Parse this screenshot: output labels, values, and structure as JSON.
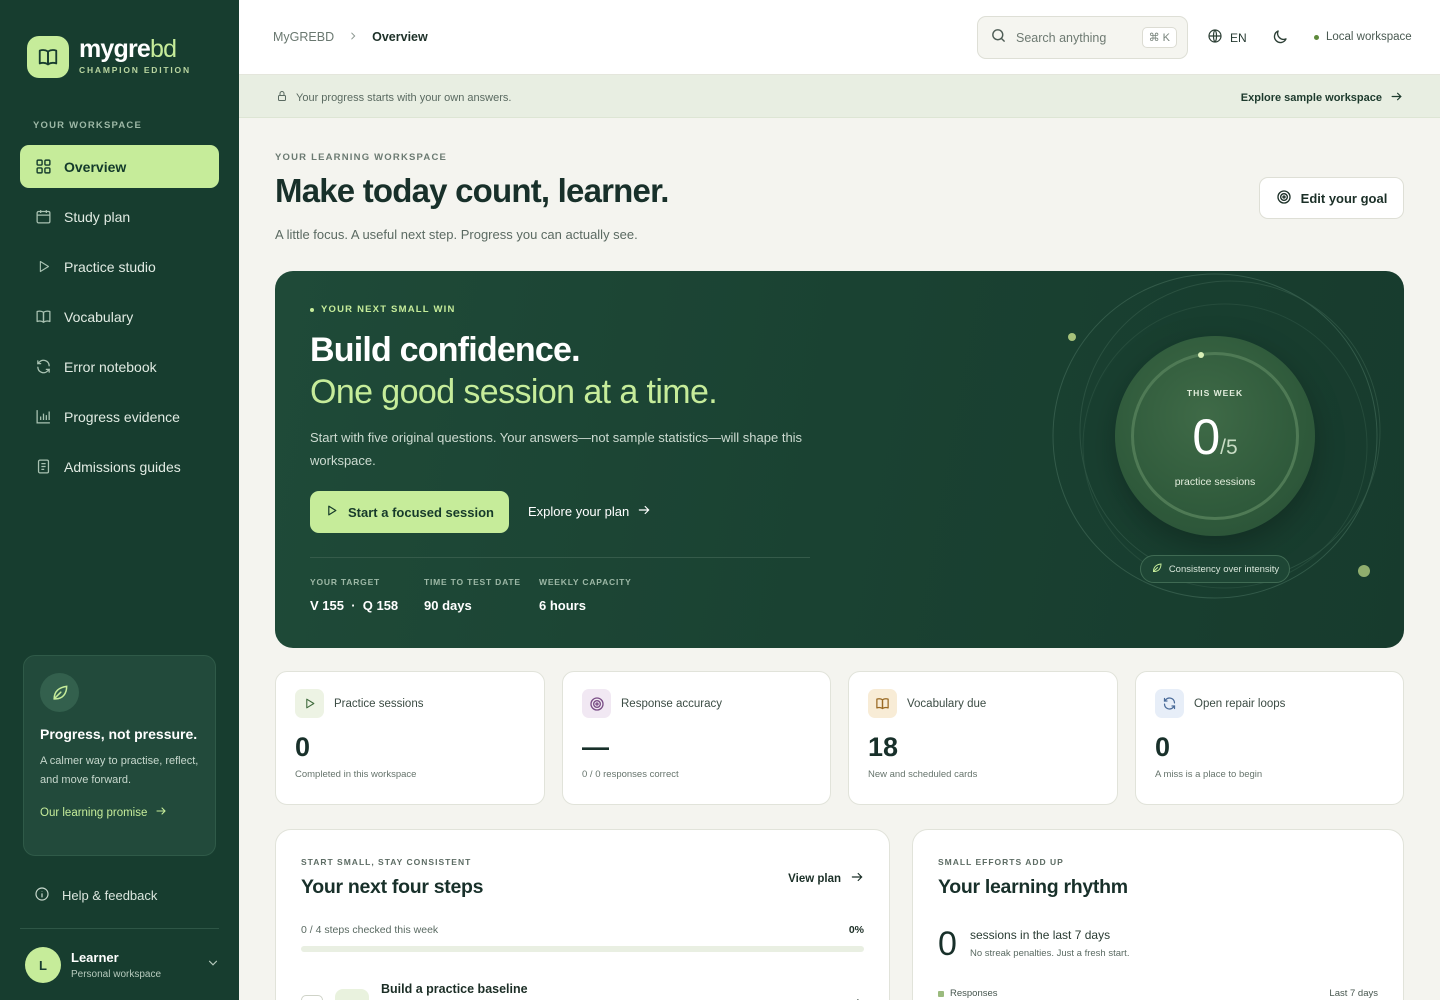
{
  "brand": {
    "name_main": "mygre",
    "name_accent": "bd",
    "edition": "CHAMPION EDITION"
  },
  "sidebar": {
    "section_label": "YOUR WORKSPACE",
    "items": [
      {
        "label": "Overview",
        "icon": "grid-icon",
        "active": true
      },
      {
        "label": "Study plan",
        "icon": "calendar-icon"
      },
      {
        "label": "Practice studio",
        "icon": "play-icon"
      },
      {
        "label": "Vocabulary",
        "icon": "book-icon"
      },
      {
        "label": "Error notebook",
        "icon": "refresh-icon"
      },
      {
        "label": "Progress evidence",
        "icon": "bar-chart-icon"
      },
      {
        "label": "Admissions guides",
        "icon": "document-icon"
      }
    ],
    "promise": {
      "title": "Progress, not pressure.",
      "body": "A calmer way to practise, reflect, and move forward.",
      "link": "Our learning promise"
    },
    "help": "Help & feedback",
    "user": {
      "initial": "L",
      "name": "Learner",
      "sub": "Personal workspace"
    }
  },
  "topbar": {
    "breadcrumb_root": "MyGREBD",
    "breadcrumb_current": "Overview",
    "search_placeholder": "Search anything",
    "search_shortcut": "⌘  K",
    "language": "EN",
    "workspace_status": "Local workspace"
  },
  "banner": {
    "message": "Your progress starts with your own answers.",
    "link": "Explore sample workspace"
  },
  "header": {
    "eyebrow": "YOUR LEARNING WORKSPACE",
    "title": "Make today count, learner.",
    "subtitle": "A little focus. A useful next step. Progress you can actually see.",
    "edit_goal": "Edit your goal"
  },
  "hero": {
    "eyebrow": "YOUR NEXT SMALL WIN",
    "title_line1": "Build confidence.",
    "title_line2": "One good session at a time.",
    "body": "Start with five original questions. Your answers—not sample statistics—will shape this workspace.",
    "primary_cta": "Start a focused session",
    "secondary_cta": "Explore your plan",
    "metrics": [
      {
        "label": "YOUR TARGET",
        "value": "V 155  ·  Q 158"
      },
      {
        "label": "TIME TO TEST DATE",
        "value": "90 days"
      },
      {
        "label": "WEEKLY CAPACITY",
        "value": "6 hours"
      }
    ],
    "ring": {
      "label": "THIS WEEK",
      "value": "0",
      "total": "/5",
      "caption": "practice sessions",
      "progress": 0
    },
    "pill": "Consistency over intensity"
  },
  "stats": [
    {
      "label": "Practice sessions",
      "value": "0",
      "sub": "Completed in this workspace",
      "icon": "play-icon",
      "icon_bg": "#edf3e4",
      "icon_color": "#3f6a3c"
    },
    {
      "label": "Response accuracy",
      "value": "—",
      "sub": "0 / 0 responses correct",
      "icon": "target-icon",
      "icon_bg": "#f1e8f3",
      "icon_color": "#7a4d86"
    },
    {
      "label": "Vocabulary due",
      "value": "18",
      "sub": "New and scheduled cards",
      "icon": "book-icon",
      "icon_bg": "#f8ecd6",
      "icon_color": "#9a6a24"
    },
    {
      "label": "Open repair loops",
      "value": "0",
      "sub": "A miss is a place to begin",
      "icon": "refresh-icon",
      "icon_bg": "#e7eef8",
      "icon_color": "#4a6b99"
    }
  ],
  "steps_panel": {
    "eyebrow": "START SMALL, STAY CONSISTENT",
    "title": "Your next four steps",
    "view_plan": "View plan",
    "progress_label": "0 / 4 steps checked this week",
    "progress_pct": "0%",
    "progress": 0,
    "first_step": "Build a practice baseline"
  },
  "rhythm_panel": {
    "eyebrow": "SMALL EFFORTS ADD UP",
    "title": "Your learning rhythm",
    "count": "0",
    "line1": "sessions in the last 7 days",
    "line2": "No streak penalties. Just a fresh start.",
    "legend": "Responses",
    "range": "Last 7 days"
  },
  "colors": {
    "sidebar": "#173d2f",
    "accent": "#c6ec9a",
    "hero": "#1f4a38"
  }
}
